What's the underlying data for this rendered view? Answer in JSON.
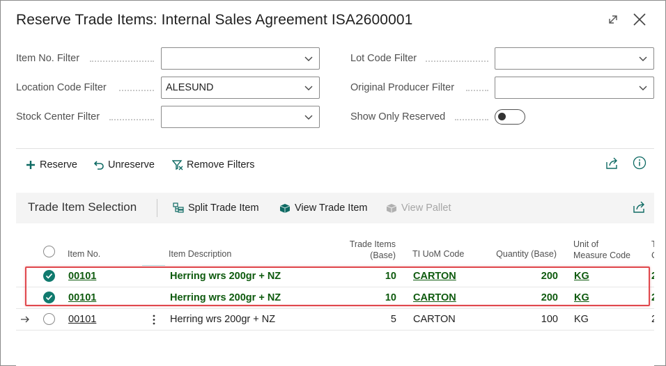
{
  "window": {
    "title": "Reserve Trade Items: Internal Sales Agreement ISA2600001",
    "expand_icon": "expand-icon",
    "close_icon": "close-icon"
  },
  "filters": {
    "item_no": {
      "label": "Item No. Filter",
      "value": ""
    },
    "location_code": {
      "label": "Location Code Filter",
      "value": "ALESUND"
    },
    "stock_center": {
      "label": "Stock Center Filter",
      "value": ""
    },
    "lot_code": {
      "label": "Lot Code Filter",
      "value": ""
    },
    "original_producer": {
      "label": "Original Producer Filter",
      "value": ""
    },
    "show_only_reserved": {
      "label": "Show Only Reserved",
      "value": false
    }
  },
  "actions": {
    "reserve": "Reserve",
    "unreserve": "Unreserve",
    "remove_filters": "Remove Filters"
  },
  "part": {
    "title": "Trade Item Selection",
    "split": "Split Trade Item",
    "view_trade_item": "View Trade Item",
    "view_pallet": "View Pallet"
  },
  "grid": {
    "headers": {
      "item_no": "Item No.",
      "item_description": "Item Description",
      "trade_items_1": "Trade Items",
      "trade_items_2": "(Base)",
      "ti_uom": "TI UoM Code",
      "quantity_base": "Quantity (Base)",
      "uom_1": "Unit of",
      "uom_2": "Measure Code",
      "next_1": "T",
      "next_2": "C"
    },
    "rows": [
      {
        "item_no": "00101",
        "description": "Herring wrs 200gr + NZ",
        "trade_items": "10",
        "ti_uom": "CARTON",
        "quantity": "200",
        "uom": "KG",
        "next": "2",
        "selected": true
      },
      {
        "item_no": "00101",
        "description": "Herring wrs 200gr + NZ",
        "trade_items": "10",
        "ti_uom": "CARTON",
        "quantity": "200",
        "uom": "KG",
        "next": "2",
        "selected": true
      },
      {
        "item_no": "00101",
        "description": "Herring wrs 200gr + NZ",
        "trade_items": "5",
        "ti_uom": "CARTON",
        "quantity": "100",
        "uom": "KG",
        "next": "2",
        "selected": false
      }
    ]
  },
  "colors": {
    "accent": "#107a6e",
    "selected_text": "#0e5a0e",
    "highlight_box": "#e0484d",
    "highlight_col": "#b3e6e8"
  }
}
